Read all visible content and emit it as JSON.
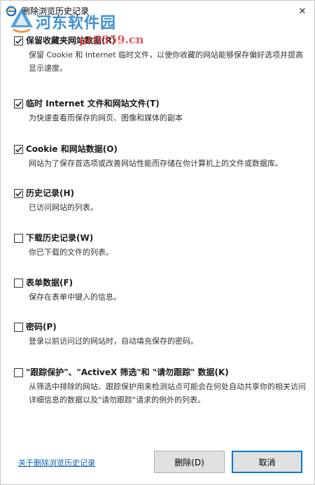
{
  "window": {
    "title": "删除浏览历史记录",
    "close_glyph": "✕"
  },
  "watermark": {
    "main": "河东软件园",
    "url": "pc0359.cn"
  },
  "options": [
    {
      "label": "保留收藏夹网站数据(R)",
      "checked": true,
      "desc": "保留 Cookie 和 Internet 临时文件，以使你收藏的网站能够保存偏好选项并提高显示速度。"
    },
    {
      "label": "临时 Internet 文件和网站文件(T)",
      "checked": true,
      "desc": "为快速查看而保存的网页、图像和媒体的副本"
    },
    {
      "label": "Cookie 和网站数据(O)",
      "checked": true,
      "desc": "网站为了保存首选项或改善网站性能而存储在你计算机上的文件或数据库。"
    },
    {
      "label": "历史记录(H)",
      "checked": true,
      "desc": "已访问网站的列表。"
    },
    {
      "label": "下载历史记录(W)",
      "checked": false,
      "desc": "你已下载的文件的列表。"
    },
    {
      "label": "表单数据(F)",
      "checked": false,
      "desc": "保存在表单中键入的信息。"
    },
    {
      "label": "密码(P)",
      "checked": false,
      "desc": "登录以前访问过的网站时，自动填充保存的密码。"
    },
    {
      "label": "\"跟踪保护\"、\"ActiveX 筛选\"和 \"请勿跟踪\" 数据(K)",
      "checked": false,
      "desc": "从筛选中排除的网站、跟踪保护用来检测站点可能会在何处自动共享你的相关访问详细信息的数据以及\"请勿跟踪\"请求的例外的列表。"
    }
  ],
  "footer": {
    "link": "关于删除浏览历史记录",
    "delete_label": "删除(D)",
    "cancel_label": "取消"
  },
  "colors": {
    "link": "#0b5fb8",
    "accent": "#0078d7",
    "button_bg": "#e1e1e1"
  }
}
